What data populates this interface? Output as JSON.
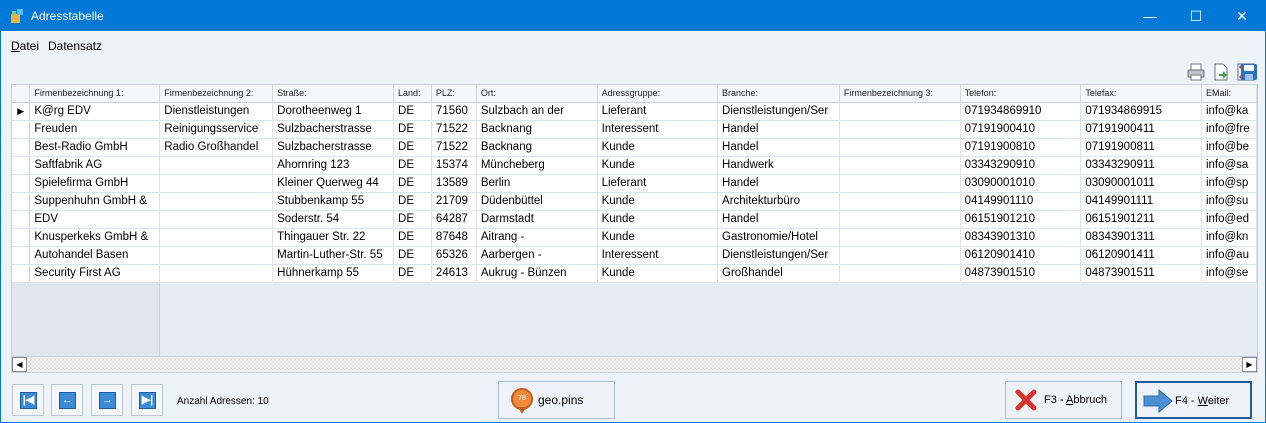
{
  "window": {
    "title": "Adresstabelle",
    "controls": {
      "minimize": "—",
      "maximize": "☐",
      "close": "✕"
    }
  },
  "menu": {
    "items": [
      {
        "label_u": "D",
        "label_rest": "atei"
      },
      {
        "label_u": "",
        "label_rest": "Datensatz"
      }
    ]
  },
  "toolbar": {
    "icons": [
      "printer-icon",
      "export-icon",
      "delete-icon",
      "save-icon"
    ]
  },
  "table": {
    "columns": [
      "Firmenbezeichnung 1:",
      "Firmenbezeichnung 2:",
      "Straße:",
      "Land:",
      "PLZ:",
      "Ort:",
      "Adressgruppe:",
      "Branche:",
      "Firmenbezeichnung 3:",
      "Telefon:",
      "Telefax:",
      "EMail:"
    ],
    "rows": [
      [
        "K@rg EDV",
        "Dienstleistungen",
        "Dorotheenweg 1",
        "DE",
        "71560",
        "Sulzbach an der",
        "Lieferant",
        "Dienstleistungen/Ser",
        "",
        "071934869910",
        "071934869915",
        "info@ka"
      ],
      [
        "Freuden",
        "Reinigungsservice",
        "Sulzbacherstrasse",
        "DE",
        "71522",
        "Backnang",
        "Interessent",
        "Handel",
        "",
        "07191900410",
        "07191900411",
        "info@fre"
      ],
      [
        "Best-Radio GmbH",
        "Radio Großhandel",
        "Sulzbacherstrasse",
        "DE",
        "71522",
        "Backnang",
        "Kunde",
        "Handel",
        "",
        "07191900810",
        "07191900811",
        "info@be"
      ],
      [
        "Saftfabrik AG",
        "",
        "Ahornring 123",
        "DE",
        "15374",
        "Müncheberg",
        "Kunde",
        "Handwerk",
        "",
        "03343290910",
        "03343290911",
        "info@sa"
      ],
      [
        "Spielefirma GmbH",
        "",
        "Kleiner Querweg 44",
        "DE",
        "13589",
        "Berlin",
        "Lieferant",
        "Handel",
        "",
        "03090001010",
        "03090001011",
        "info@sp"
      ],
      [
        "Suppenhuhn GmbH &",
        "",
        "Stubbenkamp 55",
        "DE",
        "21709",
        "Düdenbüttel",
        "Kunde",
        "Architekturbüro",
        "",
        "04149901110",
        "04149901111",
        "info@su"
      ],
      [
        "EDV",
        "",
        "Soderstr. 54",
        "DE",
        "64287",
        "Darmstadt",
        "Kunde",
        "Handel",
        "",
        "06151901210",
        "06151901211",
        "info@ed"
      ],
      [
        "Knusperkeks GmbH &",
        "",
        "Thingauer Str. 22",
        "DE",
        "87648",
        "Aitrang -",
        "Kunde",
        "Gastronomie/Hotel",
        "",
        "08343901310",
        "08343901311",
        "info@kn"
      ],
      [
        "Autohandel Basen",
        "",
        "Martin-Luther-Str. 55",
        "DE",
        "65326",
        "Aarbergen -",
        "Interessent",
        "Dienstleistungen/Ser",
        "",
        "06120901410",
        "06120901411",
        "info@au"
      ],
      [
        "Security First AG",
        "",
        "Hühnerkamp 55",
        "DE",
        "24613",
        "Aukrug - Bünzen",
        "Kunde",
        "Großhandel",
        "",
        "04873901510",
        "04873901511",
        "info@se"
      ]
    ],
    "selected_row_marker": "▶"
  },
  "scrollbar": {
    "left": "◀",
    "right": "▶"
  },
  "navigation": {
    "first": "|◀",
    "prev": "←",
    "next": "→",
    "last": "▶|",
    "count_label": "Anzahl Adressen: 10"
  },
  "geo": {
    "label": "geo.pins",
    "pin_text": "78"
  },
  "actions": {
    "cancel": {
      "prefix": "F3 - ",
      "u": "A",
      "rest": "bbruch"
    },
    "next": {
      "prefix": "F4 - ",
      "u": "W",
      "rest": "eiter"
    }
  },
  "colors": {
    "accent": "#0078d7",
    "nav": "#3a8ad6",
    "cancel": "#d9342b",
    "next_arrow": "#4a90d2"
  }
}
